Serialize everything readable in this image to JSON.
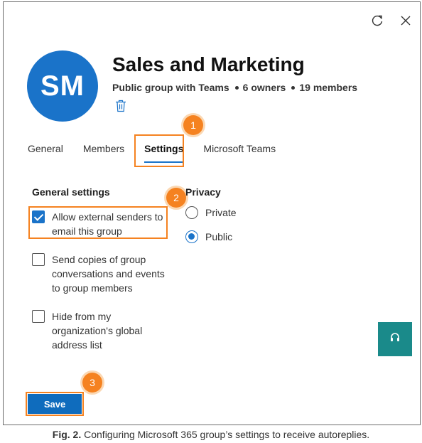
{
  "header": {
    "avatar_initials": "SM",
    "title": "Sales and Marketing",
    "subtitle_type": "Public group with Teams",
    "owners": "6 owners",
    "members": "19 members"
  },
  "icons": {
    "refresh": "refresh-icon",
    "close": "close-icon",
    "trash": "trash-icon",
    "support": "support-icon"
  },
  "tabs": [
    {
      "label": "General",
      "active": false
    },
    {
      "label": "Members",
      "active": false
    },
    {
      "label": "Settings",
      "active": true
    },
    {
      "label": "Microsoft Teams",
      "active": false
    }
  ],
  "general_settings": {
    "title": "General settings",
    "options": [
      {
        "label": "Allow external senders to email this group",
        "checked": true
      },
      {
        "label": "Send copies of group conversations and events to group members",
        "checked": false
      },
      {
        "label": "Hide from my organization's global address list",
        "checked": false
      }
    ]
  },
  "privacy": {
    "title": "Privacy",
    "options": [
      {
        "label": "Private",
        "selected": false
      },
      {
        "label": "Public",
        "selected": true
      }
    ]
  },
  "callouts": [
    "1",
    "2",
    "3"
  ],
  "save_label": "Save",
  "caption": {
    "prefix": "Fig. 2.",
    "text": "Configuring Microsoft 365 group’s settings to receive autoreplies."
  },
  "colors": {
    "accent": "#1a73c9",
    "callout": "#f58220",
    "teal": "#1a8a8a"
  }
}
